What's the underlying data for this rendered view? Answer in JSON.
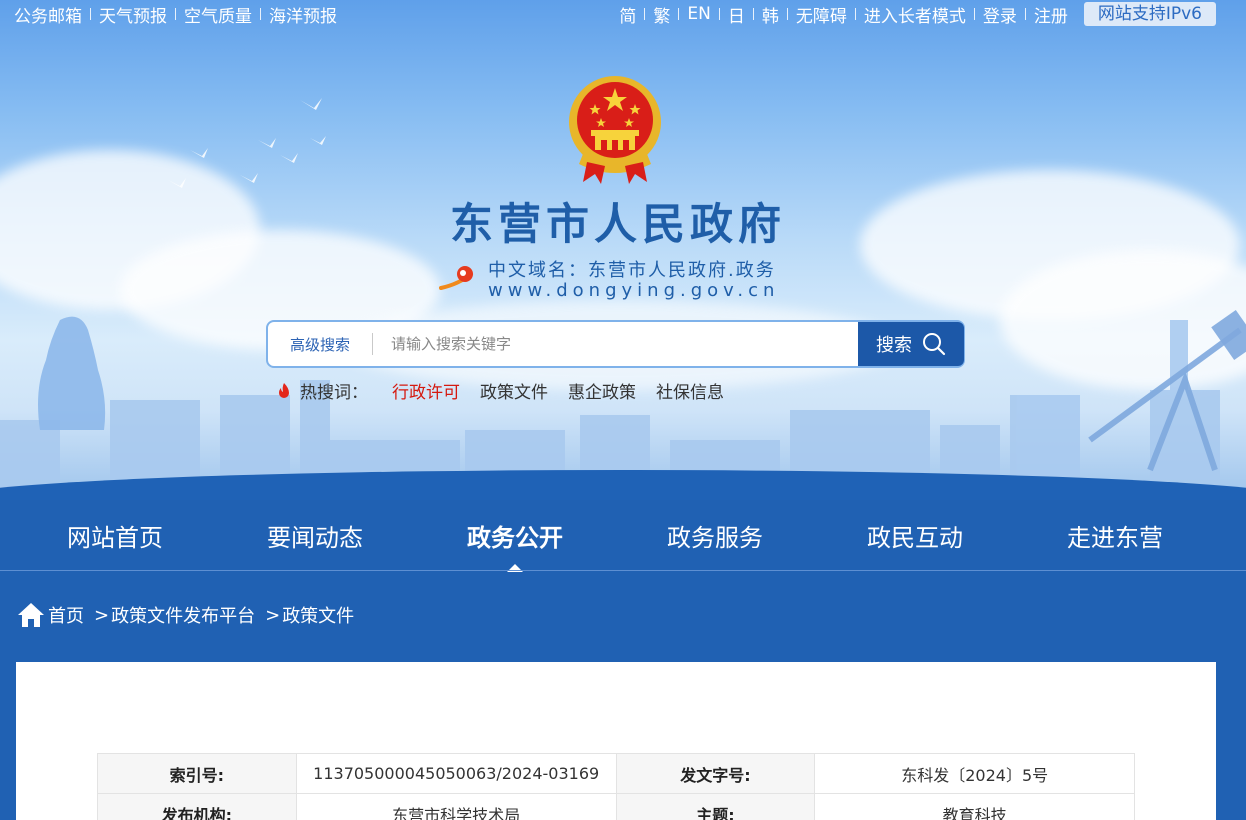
{
  "topbar": {
    "left_links": [
      "公务邮箱",
      "天气预报",
      "空气质量",
      "海洋预报"
    ],
    "right_links": [
      "简",
      "繁",
      "EN",
      "日",
      "韩",
      "无障碍",
      "进入长者模式",
      "登录",
      "注册"
    ],
    "ipv6": "网站支持IPv6"
  },
  "header": {
    "site_title": "东营市人民政府",
    "domain_cn": "中文域名：东营市人民政府.政务",
    "domain_url": "www.dongying.gov.cn"
  },
  "search": {
    "advanced_label": "高级搜索",
    "placeholder": "请输入搜索关键字",
    "button_label": "搜索"
  },
  "hot_words": {
    "label": "热搜词：",
    "items": [
      "行政许可",
      "政策文件",
      "惠企政策",
      "社保信息"
    ]
  },
  "nav": {
    "items": [
      "网站首页",
      "要闻动态",
      "政务公开",
      "政务服务",
      "政民互动",
      "走进东营"
    ],
    "active_index": 2
  },
  "breadcrumb": [
    "首页",
    "政策文件发布平台",
    "政策文件"
  ],
  "meta_table": {
    "rows": [
      [
        "索引号:",
        "113705000045050063/2024-03169",
        "发文字号:",
        "东科发〔2024〕5号"
      ],
      [
        "发布机构:",
        "东营市科学技术局",
        "主题:",
        "教育科技"
      ]
    ]
  },
  "colors": {
    "brand_blue": "#1f5ea8",
    "nav_blue": "#2061b3",
    "hot_red": "#d5190f"
  }
}
